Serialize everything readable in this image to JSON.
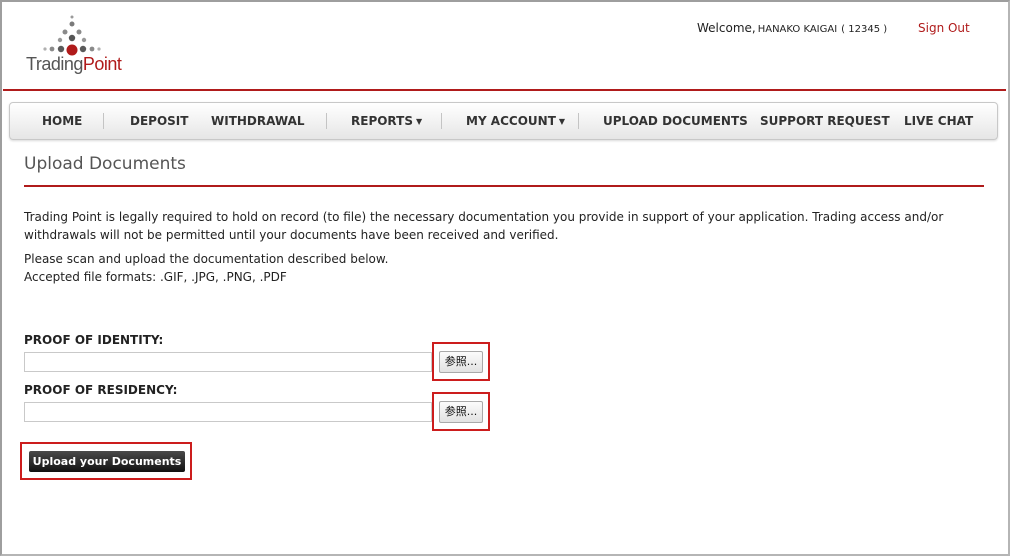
{
  "header": {
    "logo": {
      "part1": "Trading",
      "part2": "Point"
    },
    "welcome_prefix": "Welcome,",
    "user_name": "HANAKO KAIGAI",
    "account_number": "( 12345 )",
    "sign_out": "Sign Out"
  },
  "nav": {
    "items": [
      {
        "label": "HOME"
      },
      {
        "label": "DEPOSIT"
      },
      {
        "label": "WITHDRAWAL"
      },
      {
        "label": "REPORTS",
        "caret": "▼"
      },
      {
        "label": "MY ACCOUNT",
        "caret": "▼"
      },
      {
        "label": "UPLOAD DOCUMENTS"
      },
      {
        "label": "SUPPORT REQUEST"
      },
      {
        "label": "LIVE CHAT"
      }
    ]
  },
  "page": {
    "title": "Upload Documents",
    "intro": "Trading Point is legally required to hold on record (to file) the necessary documentation you provide in support of your application. Trading access and/or withdrawals will not be permitted until your documents have been received and verified.",
    "instructions": "Please scan and upload the documentation described below.",
    "formats": "Accepted file formats: .GIF, .JPG, .PNG, .PDF"
  },
  "form": {
    "identity_label": "PROOF OF IDENTITY:",
    "residency_label": "PROOF OF RESIDENCY:",
    "identity_value": "",
    "residency_value": "",
    "browse_label": "参照...",
    "submit_label": "Upload your Documents"
  },
  "colors": {
    "accent": "#b01b1b",
    "highlight": "#cc1d1d"
  }
}
